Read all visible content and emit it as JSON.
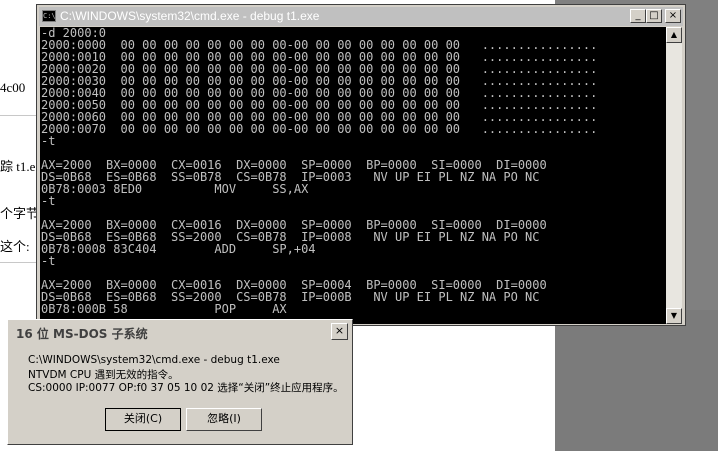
{
  "background_document": {
    "fragments": [
      "4c00",
      "踪 t1.e",
      "个字节",
      "这个:"
    ]
  },
  "cmd_window": {
    "title": "C:\\WINDOWS\\system32\\cmd.exe - debug t1.exe",
    "icon_label": "C:\\",
    "minimize_glyph": "_",
    "maximize_glyph": "□",
    "close_glyph": "×",
    "lines": [
      "-d 2000:0",
      "2000:0000  00 00 00 00 00 00 00 00-00 00 00 00 00 00 00 00   ................",
      "2000:0010  00 00 00 00 00 00 00 00-00 00 00 00 00 00 00 00   ................",
      "2000:0020  00 00 00 00 00 00 00 00-00 00 00 00 00 00 00 00   ................",
      "2000:0030  00 00 00 00 00 00 00 00-00 00 00 00 00 00 00 00   ................",
      "2000:0040  00 00 00 00 00 00 00 00-00 00 00 00 00 00 00 00   ................",
      "2000:0050  00 00 00 00 00 00 00 00-00 00 00 00 00 00 00 00   ................",
      "2000:0060  00 00 00 00 00 00 00 00-00 00 00 00 00 00 00 00   ................",
      "2000:0070  00 00 00 00 00 00 00 00-00 00 00 00 00 00 00 00   ................",
      "-t",
      "",
      "AX=2000  BX=0000  CX=0016  DX=0000  SP=0000  BP=0000  SI=0000  DI=0000",
      "DS=0B68  ES=0B68  SS=0B78  CS=0B78  IP=0003   NV UP EI PL NZ NA PO NC",
      "0B78:0003 8ED0          MOV     SS,AX",
      "-t",
      "",
      "AX=2000  BX=0000  CX=0016  DX=0000  SP=0000  BP=0000  SI=0000  DI=0000",
      "DS=0B68  ES=0B68  SS=2000  CS=0B78  IP=0008   NV UP EI PL NZ NA PO NC",
      "0B78:0008 83C404        ADD     SP,+04",
      "-t",
      "",
      "AX=2000  BX=0000  CX=0016  DX=0000  SP=0004  BP=0000  SI=0000  DI=0000",
      "DS=0B68  ES=0B68  SS=2000  CS=0B78  IP=000B   NV UP EI PL NZ NA PO NC",
      "0B78:000B 58            POP     AX"
    ]
  },
  "dialog": {
    "title": "16 位 MS-DOS 子系统",
    "close_glyph": "×",
    "message_lines": [
      "C:\\WINDOWS\\system32\\cmd.exe - debug t1.exe",
      "NTVDM CPU 遇到无效的指令。",
      "CS:0000 IP:0077 OP:f0 37 05 10 02 选择“关闭”终止应用程序。"
    ],
    "close_button": "关闭(C)",
    "ignore_button": "忽略(I)"
  },
  "colors": {
    "console_bg": "#000000",
    "console_fg": "#c0c0c0",
    "title_bar": "#c0c0c0",
    "dialog_face": "#d4d0c8"
  }
}
